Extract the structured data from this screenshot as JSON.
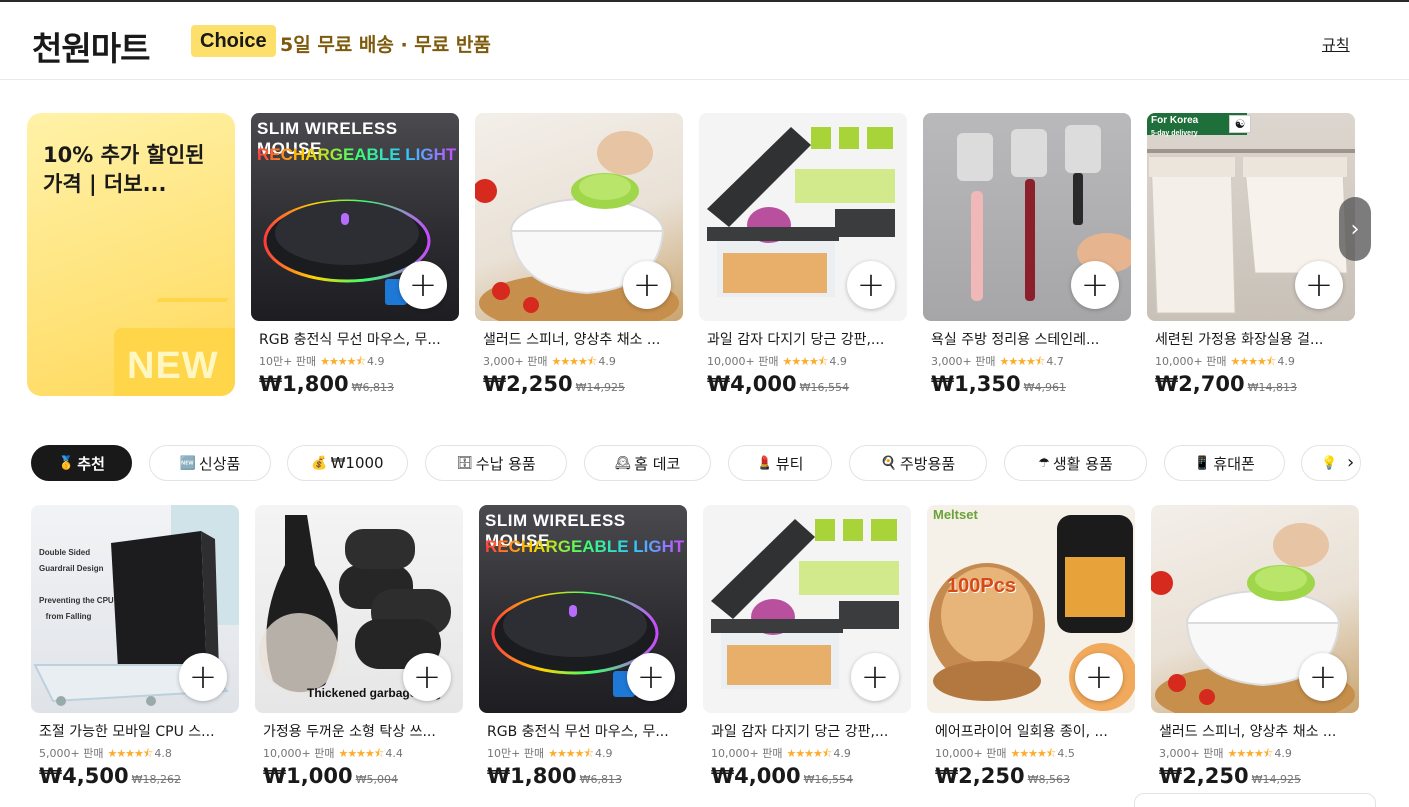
{
  "header": {
    "brand": "천원마트",
    "badge": "Choice",
    "tagline": "5일 무료 배송 · 무료 반품",
    "rules_link": "규칙"
  },
  "promo": {
    "text": "10% 추가 할인된 가격 | 더보...",
    "tag": "NEW"
  },
  "carousel": [
    {
      "title": "RGB 충전식 무선 마우스, 무...",
      "sold": "10만+ 판매",
      "rating": "4.9",
      "price": "₩1,800",
      "original": "₩6,813",
      "image": "wireless-mouse"
    },
    {
      "title": "샐러드 스피너, 양상추 채소 ...",
      "sold": "3,000+ 판매",
      "rating": "4.9",
      "price": "₩2,250",
      "original": "₩14,925",
      "image": "salad-spinner"
    },
    {
      "title": "과일 감자 다지기 당근 강판,...",
      "sold": "10,000+ 판매",
      "rating": "4.9",
      "price": "₩4,000",
      "original": "₩16,554",
      "image": "vegetable-chopper"
    },
    {
      "title": "욕실 주방 정리용 스테인레...",
      "sold": "3,000+ 판매",
      "rating": "4.7",
      "price": "₩1,350",
      "original": "₩4,961",
      "image": "wall-hooks"
    },
    {
      "title": "세련된 가정용 화장실용 걸...",
      "sold": "10,000+ 판매",
      "rating": "4.9",
      "price": "₩2,700",
      "original": "₩14,813",
      "image": "wall-trash-bin"
    }
  ],
  "categories": [
    {
      "icon": "🥇",
      "label": "추천",
      "active": true
    },
    {
      "icon": "🆕",
      "label": "신상품"
    },
    {
      "icon": "💰",
      "label": "₩1000"
    },
    {
      "icon": "🗄",
      "label": "수납 용품"
    },
    {
      "icon": "🕰",
      "label": "홈 데코"
    },
    {
      "icon": "💄",
      "label": "뷰티"
    },
    {
      "icon": "🍳",
      "label": "주방용품"
    },
    {
      "icon": "☂",
      "label": "생활 용품"
    },
    {
      "icon": "📱",
      "label": "휴대폰"
    },
    {
      "icon": "💡",
      "label": ""
    }
  ],
  "products": [
    {
      "title": "조절 가능한 모바일 CPU 스...",
      "sold": "5,000+ 판매",
      "rating": "4.8",
      "price": "₩4,500",
      "original": "₩18,262",
      "image": "cpu-stand"
    },
    {
      "title": "가정용 두꺼운 소형 탁상 쓰...",
      "sold": "10,000+ 판매",
      "rating": "4.4",
      "price": "₩1,000",
      "original": "₩5,004",
      "image": "garbage-bags"
    },
    {
      "title": "RGB 충전식 무선 마우스, 무...",
      "sold": "10만+ 판매",
      "rating": "4.9",
      "price": "₩1,800",
      "original": "₩6,813",
      "image": "wireless-mouse"
    },
    {
      "title": "과일 감자 다지기 당근 강판,...",
      "sold": "10,000+ 판매",
      "rating": "4.9",
      "price": "₩4,000",
      "original": "₩16,554",
      "image": "vegetable-chopper"
    },
    {
      "title": "에어프라이어 일회용 종이, ...",
      "sold": "10,000+ 판매",
      "rating": "4.5",
      "price": "₩2,250",
      "original": "₩8,563",
      "image": "air-fryer-liners"
    },
    {
      "title": "샐러드 스피너, 양상추 채소 ...",
      "sold": "3,000+ 판매",
      "rating": "4.9",
      "price": "₩2,250",
      "original": "₩14,925",
      "image": "salad-spinner"
    }
  ],
  "image_text": {
    "mouse_line1": "SLIM WIRELESS MOUSE",
    "mouse_line2": "RECHARGEABLE LIGHT",
    "korea_badge": "For Korea",
    "korea_sub": "5-day delivery",
    "cpu_line1": "Double Sided",
    "cpu_line2": "Guardrail Design",
    "cpu_line3": "Preventing the CPU",
    "cpu_line4": "from Falling",
    "bag_caption": "Thickened garbage bag",
    "liner_brand": "Meltset",
    "liner_count": "100Pcs"
  },
  "colors": {
    "choice_badge": "#fde06c",
    "tagline": "#7d5a0c",
    "star": "#fdac2a",
    "active_category": "#191919"
  }
}
